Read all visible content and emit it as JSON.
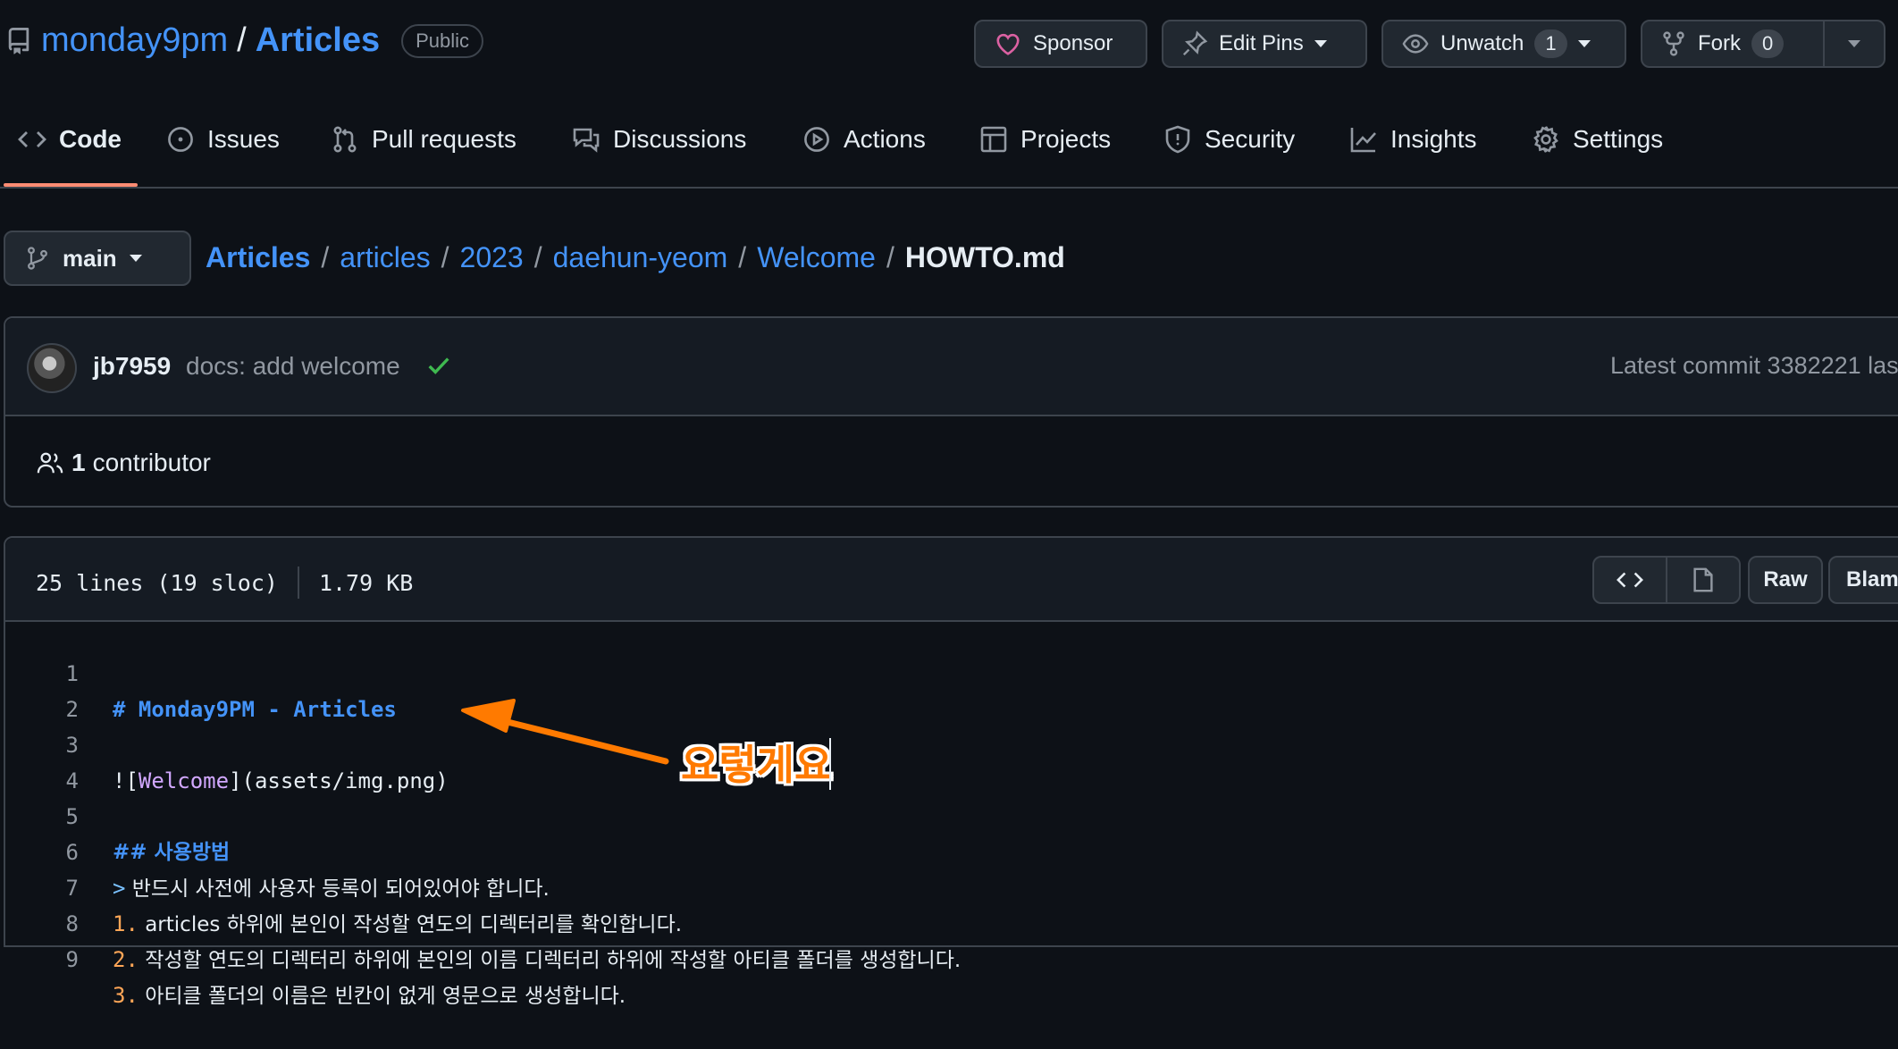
{
  "repo": {
    "owner": "monday9pm",
    "separator": "/",
    "name": "Articles",
    "visibility": "Public"
  },
  "header_buttons": {
    "sponsor": "Sponsor",
    "edit_pins": "Edit Pins",
    "unwatch": "Unwatch",
    "unwatch_count": "1",
    "fork": "Fork",
    "fork_count": "0"
  },
  "tabs": {
    "code": "Code",
    "issues": "Issues",
    "pull_requests": "Pull requests",
    "discussions": "Discussions",
    "actions": "Actions",
    "projects": "Projects",
    "security": "Security",
    "insights": "Insights",
    "settings": "Settings"
  },
  "branch": "main",
  "breadcrumb": {
    "repo": "Articles",
    "sep": "/",
    "p1": "articles",
    "p2": "2023",
    "p3": "daehun-yeom",
    "p4": "Welcome",
    "file": "HOWTO.md"
  },
  "commit": {
    "user": "jb7959",
    "message": "docs: add welcome",
    "latest": "Latest commit 3382221 las"
  },
  "contributors": {
    "count": "1",
    "label": "contributor"
  },
  "file": {
    "lines_info": "25 lines (19 sloc)",
    "size": "1.79 KB",
    "raw": "Raw",
    "blame": "Blame"
  },
  "code_lines": [
    {
      "n": "1",
      "a": "# Monday9PM - Articles"
    },
    {
      "n": "2"
    },
    {
      "n": "3",
      "a": "![",
      "b": "Welcome",
      "c": "](assets/img.png)"
    },
    {
      "n": "4"
    },
    {
      "n": "5",
      "a": "## 사용방법"
    },
    {
      "n": "6",
      "a": ">",
      "b": " 반드시 사전에 사용자 등록이 되어있어야 합니다."
    },
    {
      "n": "7",
      "a": "1.",
      "b": " articles 하위에 본인이 작성할 연도의 디렉터리를 확인합니다."
    },
    {
      "n": "8",
      "a": "2.",
      "b": " 작성할 연도의 디렉터리 하위에 본인의 이름 디렉터리 하위에 작성할 아티클 폴더를 생성합니다."
    },
    {
      "n": "9",
      "a": "3.",
      "b": " 아티클 폴더의 이름은 빈칸이 없게 영문으로 생성합니다."
    }
  ],
  "annotation": {
    "text": "요렇게요",
    "color": "#ff7a00"
  },
  "colors": {
    "accent": "#4493f8",
    "active_tab": "#fd8c73",
    "success": "#3fb950",
    "sponsor_heart": "#db61a2"
  }
}
